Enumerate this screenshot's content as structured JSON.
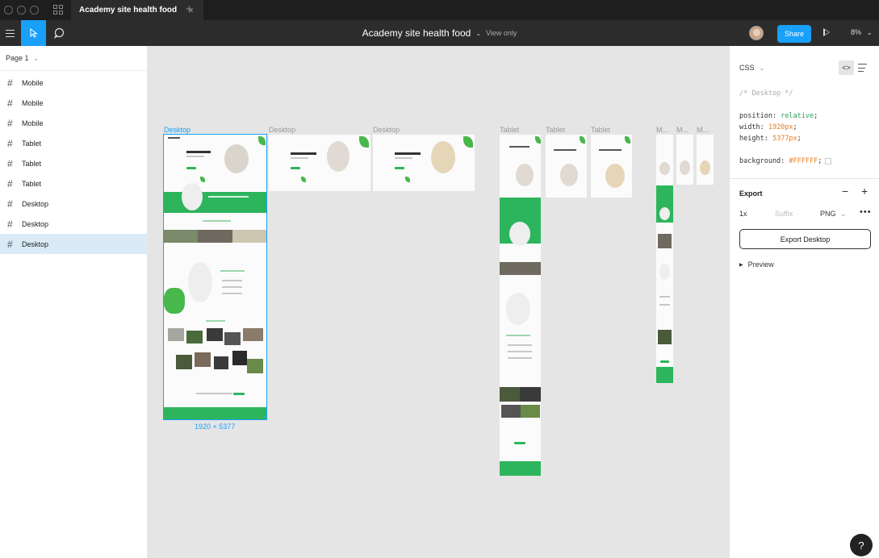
{
  "titlebar": {
    "tab_title": "Academy site health food",
    "tab_close": "×",
    "new_tab": "+"
  },
  "toolbar": {
    "document_title": "Academy site health food",
    "title_chevron": "⌄",
    "view_mode": "View only",
    "share_label": "Share",
    "zoom": "8%",
    "zoom_chevron": "⌄"
  },
  "layers_panel": {
    "page_selector": "Page 1",
    "page_chevron": "⌄",
    "layers": [
      {
        "name": "Mobile",
        "selected": false
      },
      {
        "name": "Mobile",
        "selected": false
      },
      {
        "name": "Mobile",
        "selected": false
      },
      {
        "name": "Tablet",
        "selected": false
      },
      {
        "name": "Tablet",
        "selected": false
      },
      {
        "name": "Tablet",
        "selected": false
      },
      {
        "name": "Desktop",
        "selected": false
      },
      {
        "name": "Desktop",
        "selected": false
      },
      {
        "name": "Desktop",
        "selected": true
      }
    ]
  },
  "canvas": {
    "frame_labels": {
      "desktop1": "Desktop",
      "desktop2": "Desktop",
      "desktop3": "Desktop",
      "tablet1": "Tablet",
      "tablet2": "Tablet",
      "tablet3": "Tablet",
      "mobile1": "M...",
      "mobile2": "M...",
      "mobile3": "M..."
    },
    "selection_dimensions": "1920 × 5377",
    "accent_color": "#18a0fb",
    "brand_green": "#2db55d"
  },
  "inspect_panel": {
    "code_language": "CSS",
    "code_chevron": "⌄",
    "code_toggle_icon": "<>",
    "code": {
      "comment": "/* Desktop */",
      "position_prop": "position: ",
      "position_val": "relative",
      "width_prop": "width: ",
      "width_val": "1920px",
      "height_prop": "height: ",
      "height_val": "5377px",
      "background_prop": "background: ",
      "background_val": "#FFFFFF",
      "semicolon": ";"
    },
    "export": {
      "title": "Export",
      "minus": "−",
      "plus": "+",
      "scale": "1x",
      "suffix_placeholder": "Suffix",
      "format": "PNG",
      "format_chevron": "⌄",
      "more": "•••",
      "export_button": "Export Desktop",
      "preview_label": "Preview",
      "preview_arrow": "▶"
    }
  },
  "help": "?"
}
